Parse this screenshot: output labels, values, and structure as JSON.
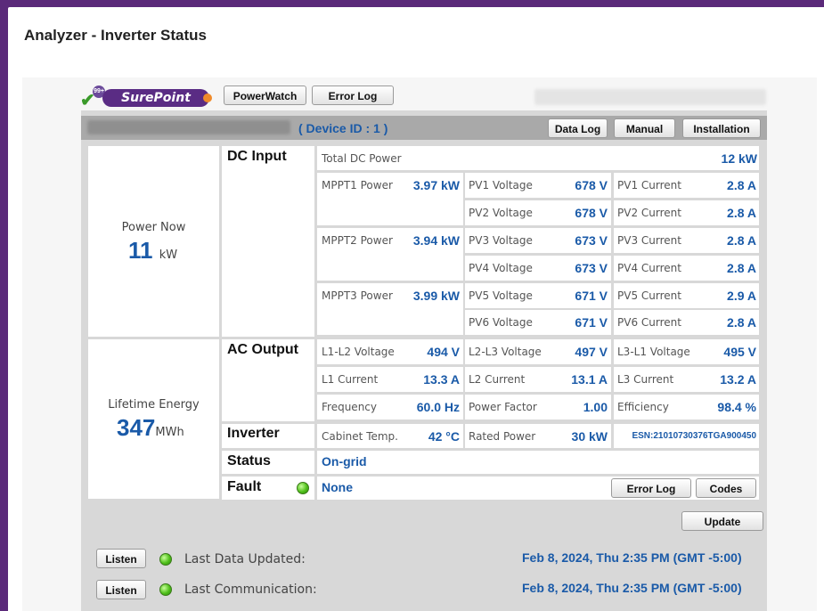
{
  "page_title": "Analyzer - Inverter Status",
  "logo": {
    "badge": "99+",
    "brand": "SurePoint"
  },
  "tabs": {
    "powerwatch": "PowerWatch",
    "error_log": "Error Log"
  },
  "device": {
    "id_label": "( Device ID : 1 )",
    "buttons": {
      "data_log": "Data Log",
      "manual": "Manual",
      "installation": "Installation"
    }
  },
  "power_now": {
    "label": "Power Now",
    "value": "11",
    "unit": "kW"
  },
  "lifetime_energy": {
    "label": "Lifetime Energy",
    "value": "347",
    "unit": "MWh"
  },
  "dc_input": {
    "title": "DC Input",
    "total_label": "Total DC Power",
    "total_value": "12 kW",
    "mppt": [
      {
        "label": "MPPT1 Power",
        "value": "3.97 kW"
      },
      {
        "label": "MPPT2 Power",
        "value": "3.94 kW"
      },
      {
        "label": "MPPT3 Power",
        "value": "3.99 kW"
      }
    ],
    "pv": [
      {
        "v_label": "PV1 Voltage",
        "v": "678 V",
        "c_label": "PV1 Current",
        "c": "2.8 A"
      },
      {
        "v_label": "PV2 Voltage",
        "v": "678 V",
        "c_label": "PV2 Current",
        "c": "2.8 A"
      },
      {
        "v_label": "PV3 Voltage",
        "v": "673 V",
        "c_label": "PV3 Current",
        "c": "2.8 A"
      },
      {
        "v_label": "PV4 Voltage",
        "v": "673 V",
        "c_label": "PV4 Current",
        "c": "2.8 A"
      },
      {
        "v_label": "PV5 Voltage",
        "v": "671 V",
        "c_label": "PV5 Current",
        "c": "2.9 A"
      },
      {
        "v_label": "PV6 Voltage",
        "v": "671 V",
        "c_label": "PV6 Current",
        "c": "2.8 A"
      }
    ]
  },
  "ac_output": {
    "title": "AC Output",
    "rows": [
      [
        {
          "l": "L1-L2 Voltage",
          "v": "494 V"
        },
        {
          "l": "L2-L3 Voltage",
          "v": "497 V"
        },
        {
          "l": "L3-L1 Voltage",
          "v": "495 V"
        }
      ],
      [
        {
          "l": "L1 Current",
          "v": "13.3 A"
        },
        {
          "l": "L2 Current",
          "v": "13.1 A"
        },
        {
          "l": "L3 Current",
          "v": "13.2 A"
        }
      ],
      [
        {
          "l": "Frequency",
          "v": "60.0 Hz"
        },
        {
          "l": "Power Factor",
          "v": "1.00"
        },
        {
          "l": "Efficiency",
          "v": "98.4 %"
        }
      ]
    ]
  },
  "inverter": {
    "title": "Inverter",
    "cabinet_label": "Cabinet Temp.",
    "cabinet_value": "42 °C",
    "rated_label": "Rated Power",
    "rated_value": "30 kW",
    "esn": "ESN:21010730376TGA900450"
  },
  "status": {
    "title": "Status",
    "value": "On-grid"
  },
  "fault": {
    "title": "Fault",
    "value": "None",
    "error_log": "Error Log",
    "codes": "Codes"
  },
  "update_button": "Update",
  "footer": {
    "listen": "Listen",
    "last_data_label": "Last Data Updated:",
    "last_data_value": "Feb 8, 2024, Thu 2:35 PM (GMT -5:00)",
    "last_comm_label": "Last Communication:",
    "last_comm_value": "Feb 8, 2024, Thu 2:35 PM (GMT -5:00)"
  },
  "colors": {
    "accent": "#1a5aa8",
    "frame": "#5b2a7a",
    "brand": "#5a2c84"
  }
}
